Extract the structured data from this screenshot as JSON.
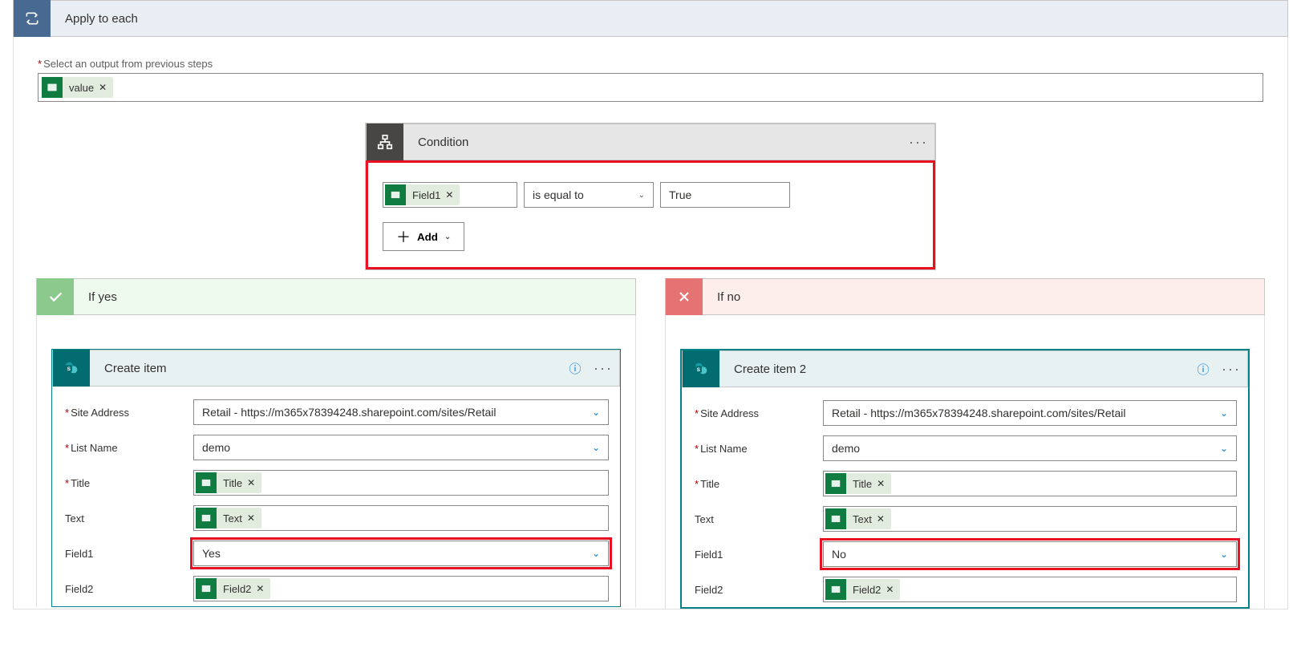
{
  "applyToEach": {
    "title": "Apply to each",
    "outputLabel": "Select an output from previous steps",
    "token": "value"
  },
  "condition": {
    "title": "Condition",
    "leftToken": "Field1",
    "operator": "is equal to",
    "rightValue": "True",
    "addLabel": "Add"
  },
  "branches": {
    "yes": {
      "title": "If yes"
    },
    "no": {
      "title": "If no"
    }
  },
  "createItemYes": {
    "title": "Create item",
    "fields": {
      "siteAddressLabel": "Site Address",
      "siteAddressValue": "Retail - https://m365x78394248.sharepoint.com/sites/Retail",
      "listNameLabel": "List Name",
      "listNameValue": "demo",
      "titleLabel": "Title",
      "titleToken": "Title",
      "textLabel": "Text",
      "textToken": "Text",
      "field1Label": "Field1",
      "field1Value": "Yes",
      "field2Label": "Field2",
      "field2Token": "Field2"
    }
  },
  "createItemNo": {
    "title": "Create item 2",
    "fields": {
      "siteAddressLabel": "Site Address",
      "siteAddressValue": "Retail - https://m365x78394248.sharepoint.com/sites/Retail",
      "listNameLabel": "List Name",
      "listNameValue": "demo",
      "titleLabel": "Title",
      "titleToken": "Title",
      "textLabel": "Text",
      "textToken": "Text",
      "field1Label": "Field1",
      "field1Value": "No",
      "field2Label": "Field2",
      "field2Token": "Field2"
    }
  }
}
